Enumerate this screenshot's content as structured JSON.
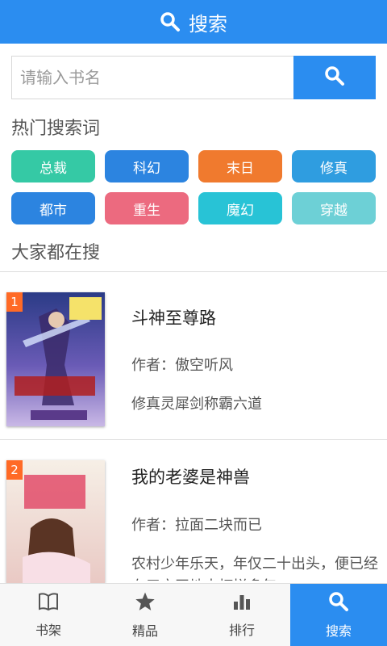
{
  "header": {
    "title": "搜索",
    "icon": "search-icon"
  },
  "search": {
    "placeholder": "请输入书名",
    "value": "",
    "button_icon": "search-icon"
  },
  "hot": {
    "title": "热门搜索词",
    "tags": [
      {
        "label": "总裁",
        "color": "#35c9a5"
      },
      {
        "label": "科幻",
        "color": "#2c84e0"
      },
      {
        "label": "末日",
        "color": "#f07a2e"
      },
      {
        "label": "修真",
        "color": "#2f9de0"
      },
      {
        "label": "都市",
        "color": "#2c84e0"
      },
      {
        "label": "重生",
        "color": "#ec6a7f"
      },
      {
        "label": "魔幻",
        "color": "#28c3d6"
      },
      {
        "label": "穿越",
        "color": "#6dd0d6"
      }
    ]
  },
  "popular": {
    "title": "大家都在搜",
    "books": [
      {
        "rank": "1",
        "title": "斗神至尊路",
        "author": "作者：傲空听风",
        "desc": "修真灵犀剑称霸六道"
      },
      {
        "rank": "2",
        "title": "我的老婆是神兽",
        "author": "作者：拉面二块而已",
        "desc": "农村少年乐天，年仅二十出头，便已经在三亩田地中打拼多年……"
      }
    ]
  },
  "tabs": [
    {
      "label": "书架",
      "icon": "book-icon",
      "active": false
    },
    {
      "label": "精品",
      "icon": "star-icon",
      "active": false
    },
    {
      "label": "排行",
      "icon": "bar-chart-icon",
      "active": false
    },
    {
      "label": "搜索",
      "icon": "search-icon",
      "active": true
    }
  ],
  "colors": {
    "brand": "#2b8df0",
    "rank_badge": "#ff6a26"
  }
}
